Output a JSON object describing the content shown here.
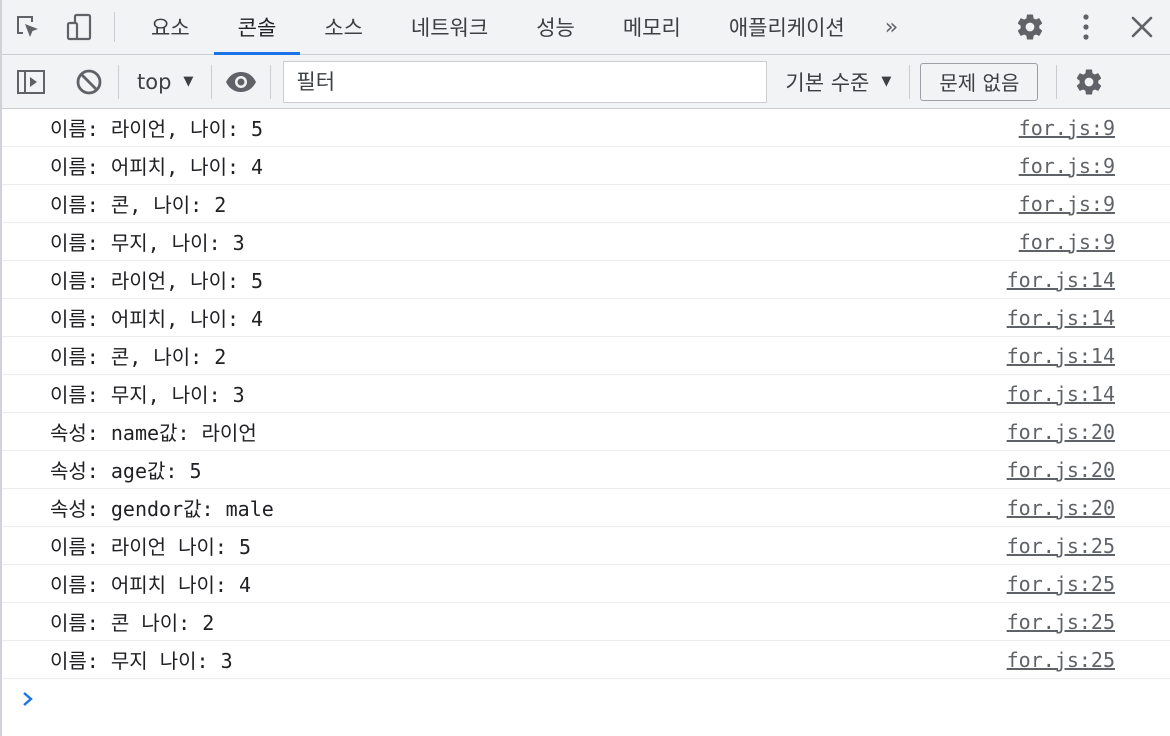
{
  "tabs": [
    {
      "label": "요소",
      "active": false
    },
    {
      "label": "콘솔",
      "active": true
    },
    {
      "label": "소스",
      "active": false
    },
    {
      "label": "네트워크",
      "active": false
    },
    {
      "label": "성능",
      "active": false
    },
    {
      "label": "메모리",
      "active": false
    },
    {
      "label": "애플리케이션",
      "active": false
    }
  ],
  "more_tabs": "»",
  "toolbar": {
    "context": "top",
    "filter_placeholder": "필터",
    "levels": "기본 수준",
    "issues": "문제 없음"
  },
  "logs": [
    {
      "message": "이름: 라이언, 나이: 5",
      "source": "for.js:9"
    },
    {
      "message": "이름: 어피치, 나이: 4",
      "source": "for.js:9"
    },
    {
      "message": "이름: 콘, 나이: 2",
      "source": "for.js:9"
    },
    {
      "message": "이름: 무지, 나이: 3",
      "source": "for.js:9"
    },
    {
      "message": "이름: 라이언, 나이: 5",
      "source": "for.js:14"
    },
    {
      "message": "이름: 어피치, 나이: 4",
      "source": "for.js:14"
    },
    {
      "message": "이름: 콘, 나이: 2",
      "source": "for.js:14"
    },
    {
      "message": "이름: 무지, 나이: 3",
      "source": "for.js:14"
    },
    {
      "message": "속성: name값: 라이언",
      "source": "for.js:20"
    },
    {
      "message": "속성: age값: 5",
      "source": "for.js:20"
    },
    {
      "message": "속성: gendor값: male",
      "source": "for.js:20"
    },
    {
      "message": "이름: 라이언 나이: 5",
      "source": "for.js:25"
    },
    {
      "message": "이름: 어피치 나이: 4",
      "source": "for.js:25"
    },
    {
      "message": "이름: 콘 나이: 2",
      "source": "for.js:25"
    },
    {
      "message": "이름: 무지 나이: 3",
      "source": "for.js:25"
    }
  ],
  "colors": {
    "accent": "#1a73e8",
    "icon": "#5f6368",
    "prompt": "#1a73e8"
  }
}
